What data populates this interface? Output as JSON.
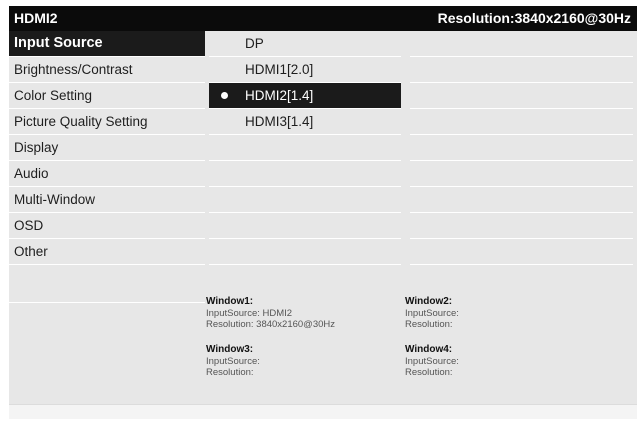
{
  "title": {
    "left": "HDMI2",
    "right": "Resolution:3840x2160@30Hz"
  },
  "menu": [
    {
      "label": "Input Source",
      "active": true
    },
    {
      "label": "Brightness/Contrast",
      "active": false
    },
    {
      "label": "Color Setting",
      "active": false
    },
    {
      "label": "Picture Quality Setting",
      "active": false
    },
    {
      "label": "Display",
      "active": false
    },
    {
      "label": "Audio",
      "active": false
    },
    {
      "label": "Multi-Window",
      "active": false
    },
    {
      "label": "OSD",
      "active": false
    },
    {
      "label": "Other",
      "active": false
    }
  ],
  "options": [
    {
      "label": "DP",
      "selected": false
    },
    {
      "label": "HDMI1[2.0]",
      "selected": false
    },
    {
      "label": "HDMI2[1.4]",
      "selected": true
    },
    {
      "label": "HDMI3[1.4]",
      "selected": false
    }
  ],
  "windows": {
    "w1": {
      "title": "Window1:",
      "input": "InputSource: HDMI2",
      "resolution": "Resolution: 3840x2160@30Hz"
    },
    "w2": {
      "title": "Window2:",
      "input": "InputSource:",
      "resolution": "Resolution:"
    },
    "w3": {
      "title": "Window3:",
      "input": "InputSource:",
      "resolution": "Resolution:"
    },
    "w4": {
      "title": "Window4:",
      "input": "InputSource:",
      "resolution": "Resolution:"
    }
  }
}
